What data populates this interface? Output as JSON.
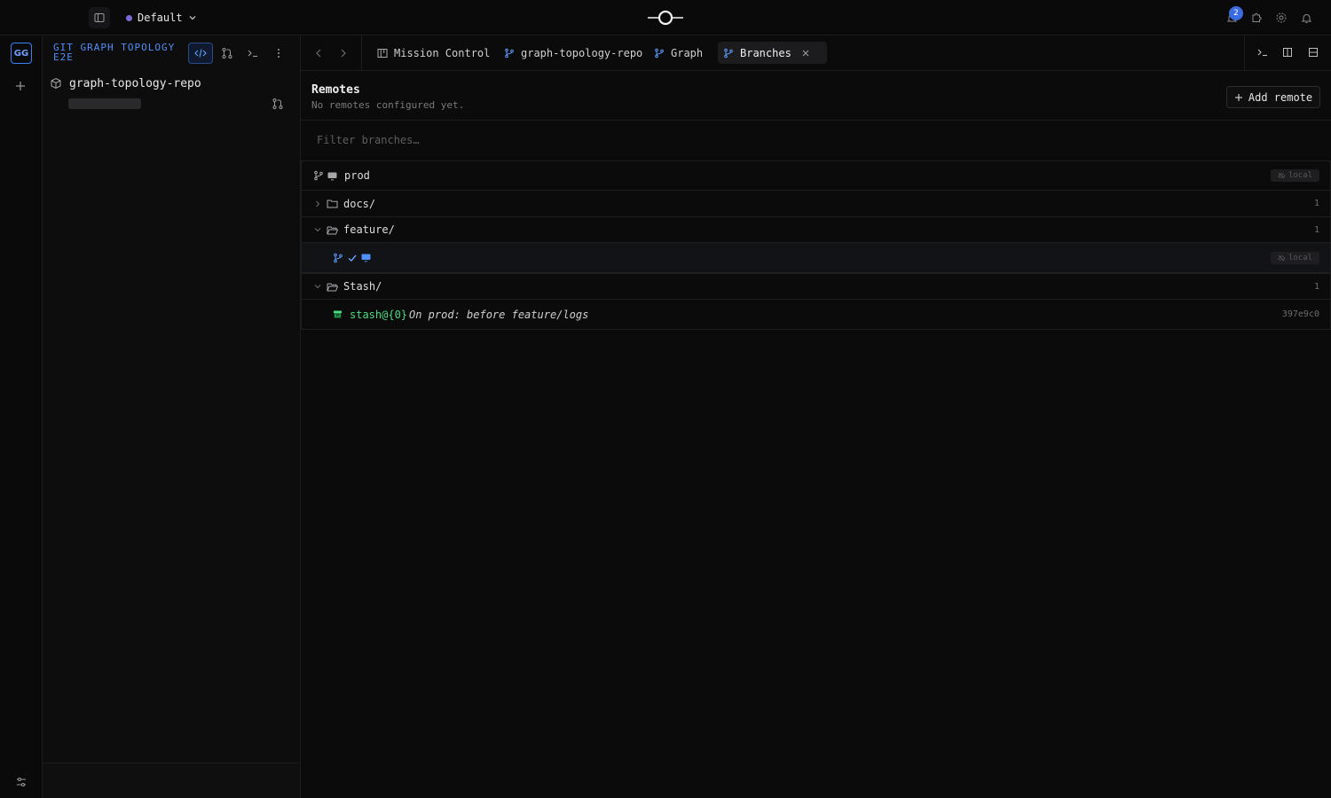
{
  "topbar": {
    "workspace": "Default",
    "notification_count": "2"
  },
  "rail": {
    "workspace_initials": "GG"
  },
  "panel": {
    "project_title": "GIT GRAPH TOPOLOGY E2E",
    "repo_name": "graph-topology-repo"
  },
  "tabs": [
    {
      "label": "Mission Control",
      "icon": "kanban-icon"
    },
    {
      "label": "graph-topology-repo",
      "icon": "branch-icon"
    },
    {
      "label": "Graph",
      "icon": "branch-icon"
    },
    {
      "label": "Branches",
      "icon": "branch-icon",
      "active": true
    }
  ],
  "remotes": {
    "title": "Remotes",
    "subtitle": "No remotes configured yet.",
    "add_label": "Add remote"
  },
  "filter": {
    "placeholder": "Filter branches…"
  },
  "branches": {
    "prod": {
      "name": "prod",
      "badge": "local"
    },
    "groups": [
      {
        "name": "docs/",
        "count": "1"
      },
      {
        "name": "feature/",
        "count": "1"
      },
      {
        "name": "Stash/",
        "count": "1"
      }
    ],
    "feature_item": {
      "badge": "local"
    },
    "stash": {
      "ref": "stash@{0}",
      "message": "On prod: before feature/logs",
      "hash": "397e9c0"
    }
  },
  "colors": {
    "accent": "#3b82f6",
    "stash_green": "#4ade80"
  }
}
